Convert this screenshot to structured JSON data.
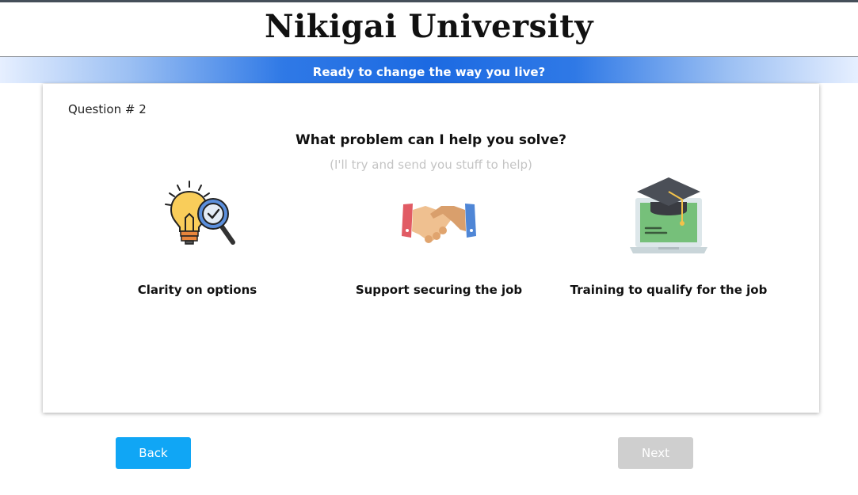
{
  "header": {
    "title": "Nikigai University",
    "tagline": "Ready to change the way you live?"
  },
  "question": {
    "number_label": "Question # 2",
    "text": "What problem can I help you solve?",
    "hint": "(I'll try and send you stuff to help)",
    "options": [
      {
        "label": "Clarity on options",
        "icon": "lightbulb-magnifier-icon"
      },
      {
        "label": "Support securing the job",
        "icon": "handshake-icon"
      },
      {
        "label": "Training to qualify for the job",
        "icon": "graduation-laptop-icon"
      }
    ]
  },
  "nav": {
    "back_label": "Back",
    "next_label": "Next",
    "back_color": "#10a6f5",
    "next_color": "#cfcfcf"
  },
  "colors": {
    "tagline_band": "#1c6ae2",
    "hint_text": "#c4c4c4"
  }
}
